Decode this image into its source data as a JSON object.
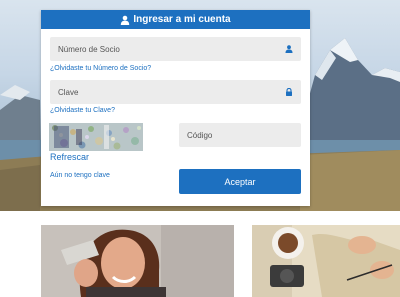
{
  "login": {
    "title": "Ingresar a mi cuenta",
    "member_field": {
      "placeholder": "Número de Socio",
      "value": ""
    },
    "forgot_member_link": "¿Olvidaste tu Número de Socio?",
    "password_field": {
      "placeholder": "Clave",
      "value": ""
    },
    "forgot_password_link": "¿Olvidaste tu Clave?",
    "refresh_link": "Refrescar",
    "code_field": {
      "placeholder": "Código",
      "value": ""
    },
    "no_password_link": "Aún no tengo clave",
    "submit_label": "Aceptar"
  },
  "icons": {
    "header": "user-icon",
    "member_field": "user-icon",
    "password_field": "lock-icon"
  },
  "colors": {
    "primary": "#1d70c0",
    "field_bg": "#ececec",
    "link": "#1d70c0"
  }
}
